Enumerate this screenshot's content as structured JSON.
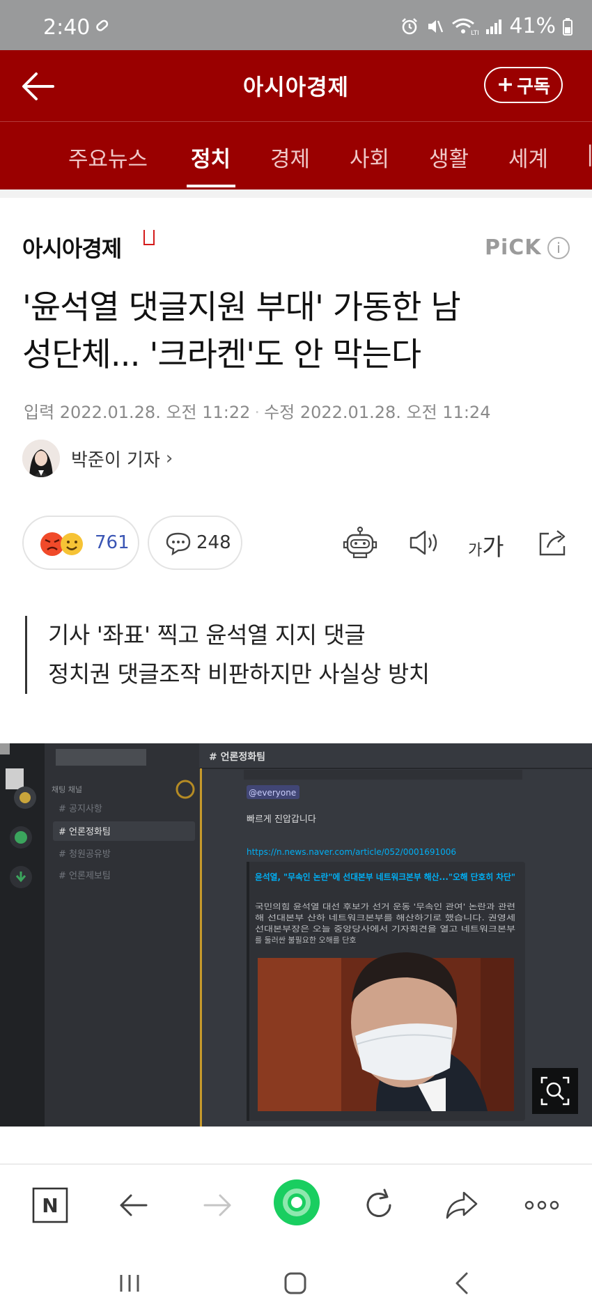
{
  "status_bar": {
    "time": "2:40",
    "battery": "41%"
  },
  "header": {
    "title": "아시아경제",
    "subscribe_label": "구독"
  },
  "tabs": [
    "주요뉴스",
    "정치",
    "경제",
    "사회",
    "생활",
    "세계"
  ],
  "active_tab": "정치",
  "article": {
    "press_name": "아시아경제",
    "pick_label": "PiCK",
    "title_line1": "'윤석열 댓글지원 부대' 가동한 남",
    "title_line2": "성단체... '크라켄'도 안 막는다",
    "input_date": "입력 2022.01.28. 오전 11:22",
    "modified_date": "수정 2022.01.28. 오전 11:24",
    "reporter": "박준이 기자",
    "reaction_count": "761",
    "comment_count": "248",
    "font_size_label_small": "가",
    "font_size_label_large": "가",
    "summary": [
      "기사 '좌표' 찍고 윤석열 지지 댓글",
      "정치권 댓글조작 비판하지만 사실상 방치"
    ]
  },
  "image": {
    "channel_header": "# 언론정화팀",
    "category": "채팅 채널",
    "channels": [
      "# 공지사항",
      "# 언론정화팀",
      "# 청원공유방",
      "# 언론제보팀"
    ],
    "mention": "@everyone",
    "message": "빠르게 진압갑니다",
    "link": "https://n.news.naver.com/article/052/0001691006",
    "embed_title": "윤석열, \"무속인 논란\"에 선대본부 네트워크본부 해산...\"오해 단호히 차단\"",
    "embed_body_1": "국민의힘 윤석열 대선 후보가 선거 운동 '무속인 관여' 논란과 관련",
    "embed_body_2": "해 선대본부 산하 네트워크본부를 해산하기로 했습니다. 권영세",
    "embed_body_3": "선대본부장은 오늘 중앙당사에서 기자회견을 열고 네트워크본부",
    "embed_body_4": "를 둘러싼 불필요한 오해를 단호"
  },
  "toolbar": {
    "n_label": "N"
  },
  "colors": {
    "brand_red": "#9a0000",
    "reaction_blue": "#3a55b4",
    "naver_green": "#19ce60"
  },
  "icons": {
    "status": [
      "paperclip-icon",
      "alarm-icon",
      "mute-icon",
      "wifi-icon",
      "signal-icon",
      "battery-icon"
    ],
    "tools": [
      "robot-icon",
      "speaker-icon",
      "share-icon"
    ],
    "toolbar": [
      "back-icon",
      "forward-icon",
      "home-icon",
      "refresh-icon",
      "share-icon",
      "more-icon"
    ],
    "nav": [
      "recents-icon",
      "home-nav-icon",
      "back-nav-icon"
    ]
  }
}
